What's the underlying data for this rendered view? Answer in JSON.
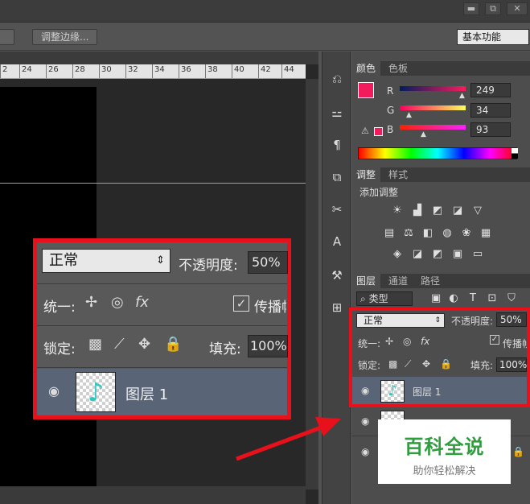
{
  "titlebar": {
    "minimize": "▬",
    "restore": "⧉",
    "close": "✕"
  },
  "options_bar": {
    "refine_edge_button": "调整边缘...",
    "workspace": "基本功能"
  },
  "ruler": {
    "ticks": [
      "2",
      "24",
      "26",
      "28",
      "30",
      "32",
      "34",
      "36",
      "38",
      "40",
      "42",
      "44"
    ]
  },
  "color_panel": {
    "tabs": [
      "颜色",
      "色板"
    ],
    "foreground_color": "#f21c5d",
    "r": {
      "label": "R",
      "value": "249"
    },
    "g": {
      "label": "G",
      "value": "34"
    },
    "b": {
      "label": "B",
      "value": "93"
    }
  },
  "adjustments_panel": {
    "tabs": [
      "调整",
      "样式"
    ],
    "title": "添加调整",
    "icons_row1": [
      "☀",
      "▟",
      "◩",
      "◪",
      "▽"
    ],
    "icons_row2": [
      "▤",
      "⚖",
      "◧",
      "◍",
      "❀",
      "▦"
    ],
    "icons_row3": [
      "◈",
      "◪",
      "◩",
      "▣",
      "▭"
    ]
  },
  "layers_panel": {
    "tabs": [
      "图层",
      "通道",
      "路径"
    ],
    "filter_label": "类型",
    "filter_icons": [
      "▣",
      "◐",
      "T",
      "⊡",
      "⛉"
    ],
    "blend_mode": "正常",
    "opacity_label": "不透明度:",
    "opacity_value": "50%",
    "unify_label": "统一:",
    "propagate_label": "传播帧",
    "lock_label": "锁定:",
    "fill_label": "填充:",
    "fill_value": "100%",
    "layer1_name": "图层 1"
  },
  "callout": {
    "blend_mode": "正常",
    "opacity_label": "不透明度:",
    "opacity_value": "50%",
    "unify_label": "统一:",
    "propagate_label": "传播帧",
    "lock_label": "锁定:",
    "fill_label": "填充:",
    "fill_value": "100%",
    "layer_name": "图层 1"
  },
  "watermark": {
    "title": "百科全说",
    "subtitle": "助你轻松解决"
  },
  "colors": {
    "highlight_red": "#e8101a",
    "selected_layer": "#596577",
    "guide": "#3ec4e9"
  }
}
